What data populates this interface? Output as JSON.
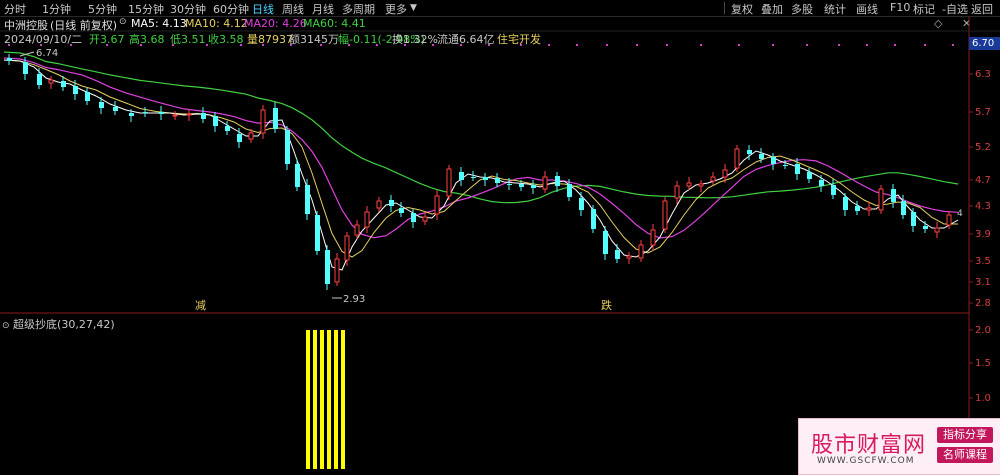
{
  "toolbar": {
    "periods": [
      "分时",
      "1分钟",
      "5分钟",
      "15分钟",
      "30分钟",
      "60分钟",
      "日线",
      "周线",
      "月线",
      "多周期",
      "更多"
    ],
    "active": "日线",
    "right_buttons": [
      "复权",
      "叠加",
      "多股",
      "统计",
      "画线",
      "F10",
      "标记",
      "-自选",
      "返回"
    ]
  },
  "stock": {
    "name": "中洲控股",
    "mode": "(日线 前复权)",
    "ma5": "MA5: 4.13",
    "ma10": "MA10: 4.12",
    "ma20": "MA20: 4.26",
    "ma60": "MA60: 4.41"
  },
  "info": {
    "date": "2024/09/10/二",
    "open": "开3.67",
    "high": "高3.68",
    "low": "低3.51",
    "close": "收3.58",
    "vol": "量87937",
    "amount": "额3145万",
    "change": "幅-0.11(-2.98%)",
    "turnover": "换1.32%",
    "float": "流通6.64亿",
    "sector": "住宅开发"
  },
  "price_axis": [
    "6.70",
    "6.3",
    "5.7",
    "5.2",
    "4.7",
    "4.3",
    "3.9",
    "3.5",
    "3.1",
    "2.8"
  ],
  "annotations": {
    "max_label": "6.74",
    "min_label": "2.93",
    "marker_1": "减",
    "marker_2": "跌",
    "badge": "4"
  },
  "indicator": {
    "title": "超级抄底(30,27,42)",
    "axis": [
      "2.0",
      "1.5",
      "1.0",
      "0.5"
    ]
  },
  "watermark": {
    "name": "股市财富网",
    "url": "WWW.GSCFW.COM",
    "tag1": "指标分享",
    "tag2": "名师课程"
  },
  "colors": {
    "up": "#ff4040",
    "down": "#54ffff",
    "ma5": "#ffffff",
    "ma10": "#e6d060",
    "ma20": "#e040e0",
    "ma60": "#40d040",
    "signal": "#ffff00"
  }
}
